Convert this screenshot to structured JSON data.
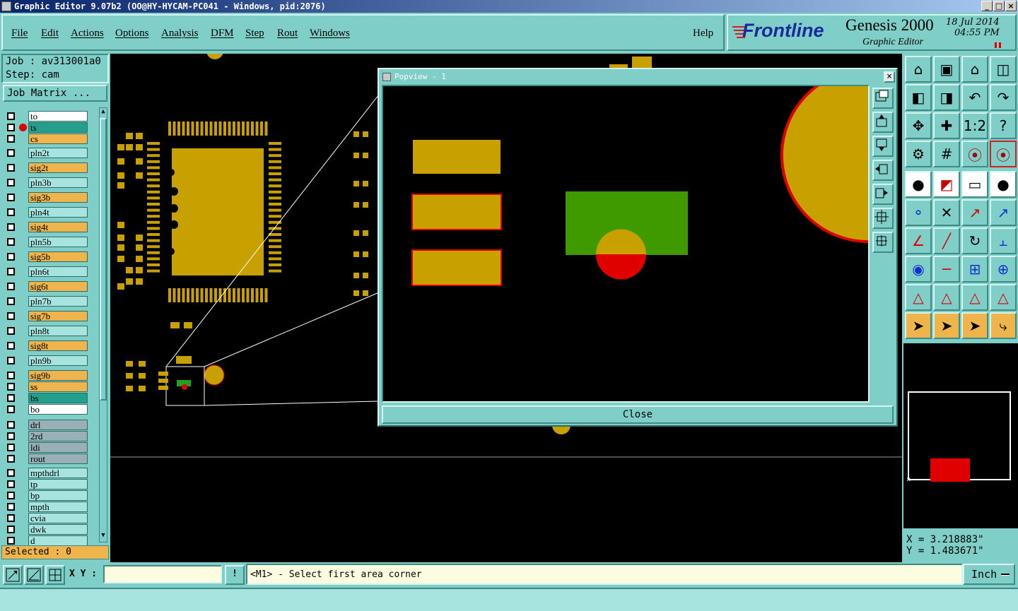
{
  "window": {
    "title": "Graphic Editor 9.07b2 (OO@HY-HYCAM-PC041 - Windows, pid:2076)"
  },
  "menu": [
    "File",
    "Edit",
    "Actions",
    "Options",
    "Analysis",
    "DFM",
    "Step",
    "Rout",
    "Windows"
  ],
  "help": "Help",
  "brand": {
    "logo": "Frontline",
    "product": "Genesis 2000",
    "subtitle": "Graphic Editor",
    "date": "18 Jul 2014",
    "time": "04:55 PM"
  },
  "job": {
    "job_label": "Job : av313001a0",
    "step_label": "Step: cam",
    "matrix_button": "Job Matrix ..."
  },
  "layers": [
    {
      "name": "to",
      "color": "#ffffff"
    },
    {
      "name": "ts",
      "color": "#23a08c",
      "active": true
    },
    {
      "name": "cs",
      "color": "#f0b44c"
    },
    {
      "name": "pln2t",
      "color": "#a8e4df"
    },
    {
      "name": "sig2t",
      "color": "#f0b44c"
    },
    {
      "name": "pln3b",
      "color": "#a8e4df"
    },
    {
      "name": "sig3b",
      "color": "#f0b44c"
    },
    {
      "name": "pln4t",
      "color": "#a8e4df"
    },
    {
      "name": "sig4t",
      "color": "#f0b44c"
    },
    {
      "name": "pln5b",
      "color": "#a8e4df"
    },
    {
      "name": "sig5b",
      "color": "#f0b44c"
    },
    {
      "name": "pln6t",
      "color": "#a8e4df"
    },
    {
      "name": "sig6t",
      "color": "#f0b44c"
    },
    {
      "name": "pln7b",
      "color": "#a8e4df"
    },
    {
      "name": "sig7b",
      "color": "#f0b44c"
    },
    {
      "name": "pln8t",
      "color": "#a8e4df"
    },
    {
      "name": "sig8t",
      "color": "#f0b44c"
    },
    {
      "name": "pln9b",
      "color": "#a8e4df"
    },
    {
      "name": "sig9b",
      "color": "#f0b44c"
    },
    {
      "name": "ss",
      "color": "#f0b44c"
    },
    {
      "name": "bs",
      "color": "#23a08c"
    },
    {
      "name": "bo",
      "color": "#ffffff"
    },
    {
      "name": "drl",
      "color": "#9ab0b8"
    },
    {
      "name": "2rd",
      "color": "#9ab0b8"
    },
    {
      "name": "ldi",
      "color": "#9ab0b8"
    },
    {
      "name": "rout",
      "color": "#9ab0b8"
    },
    {
      "name": "mpthdrl",
      "color": "#a8e4df"
    },
    {
      "name": "tp",
      "color": "#a8e4df"
    },
    {
      "name": "bp",
      "color": "#a8e4df"
    },
    {
      "name": "mpth",
      "color": "#a8e4df"
    },
    {
      "name": "cvia",
      "color": "#a8e4df"
    },
    {
      "name": "dwk",
      "color": "#a8e4df"
    },
    {
      "name": "d",
      "color": "#a8e4df"
    }
  ],
  "selected": "Selected : 0",
  "popview": {
    "title": "Popview - 1",
    "close_label": "Close"
  },
  "coords": {
    "x": "X  =  3.218883\"",
    "y": "Y  =  1.483671\""
  },
  "bottom": {
    "xy_label": "X Y :",
    "xy_value": "",
    "prompt": "<M1> - Select first area corner",
    "unit": "Inch"
  }
}
